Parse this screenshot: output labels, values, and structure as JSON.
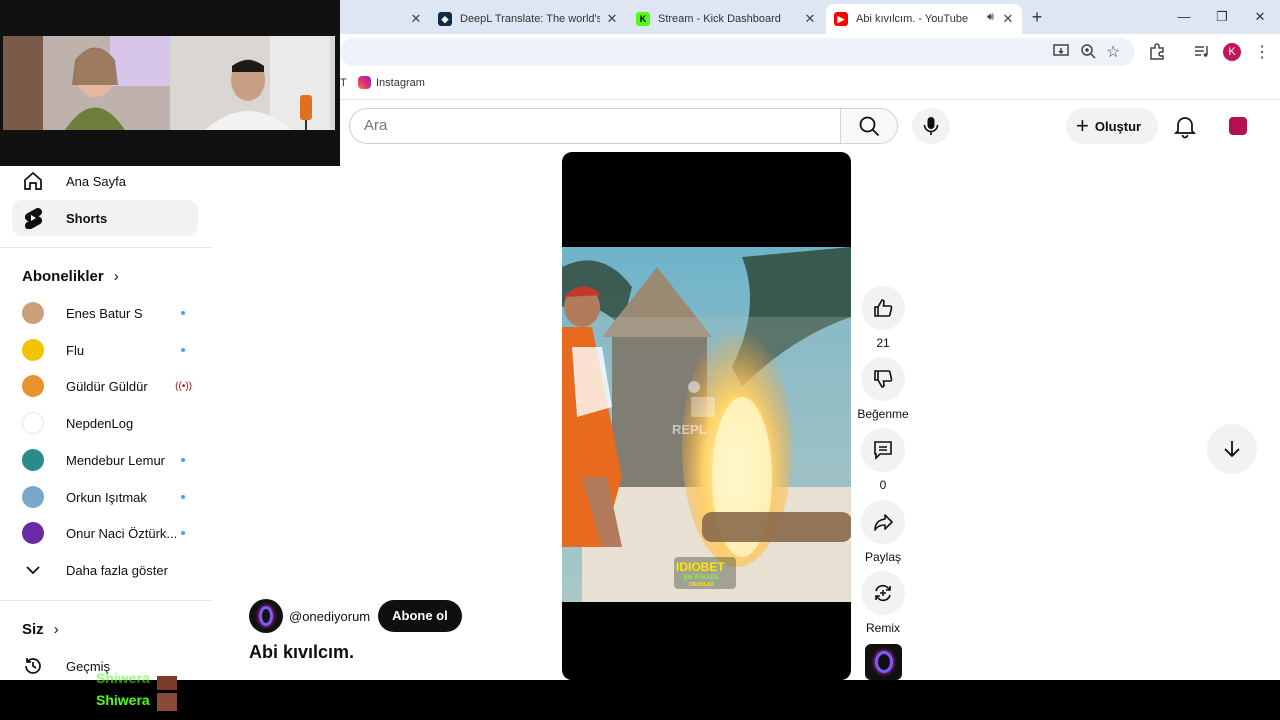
{
  "browser": {
    "tabs": [
      {
        "title": "",
        "favicon": "blank"
      },
      {
        "title": "DeepL Translate: The world's m",
        "favicon": "deepl-icon"
      },
      {
        "title": "Stream - Kick Dashboard",
        "favicon": "kick-icon"
      },
      {
        "title": "Abi kıvılcım. - YouTube",
        "favicon": "youtube-icon"
      }
    ],
    "bookmarks": [
      {
        "label": "T"
      },
      {
        "label": "Instagram"
      }
    ],
    "profile_initial": "K"
  },
  "header": {
    "search_placeholder": "Ara",
    "create_label": "Oluştur"
  },
  "sidebar": {
    "nav": [
      {
        "label": "Ana Sayfa",
        "icon": "home-icon"
      },
      {
        "label": "Shorts",
        "icon": "shorts-icon",
        "active": true
      }
    ],
    "subscriptions_title": "Abonelikler",
    "subscriptions": [
      {
        "name": "Enes Batur S",
        "indicator": "dot",
        "color": "#c9a07a"
      },
      {
        "name": "Flu",
        "indicator": "dot",
        "color": "#f5c400"
      },
      {
        "name": "Güldür Güldür",
        "indicator": "live",
        "color": "#e8912d"
      },
      {
        "name": "NepdenLog",
        "indicator": "none",
        "color": "#ffffff"
      },
      {
        "name": "Mendebur Lemur",
        "indicator": "dot",
        "color": "#2b8a8a"
      },
      {
        "name": "Orkun Işıtmak",
        "indicator": "dot",
        "color": "#7aa7c7"
      },
      {
        "name": "Onur Naci Öztürk...",
        "indicator": "dot",
        "color": "#6a2aa8"
      }
    ],
    "show_more": "Daha fazla göster",
    "you_title": "Siz",
    "history": "Geçmiş"
  },
  "short": {
    "likes": "21",
    "dislike_label": "Beğenme",
    "comments": "0",
    "share_label": "Paylaş",
    "remix_label": "Remix",
    "channel_handle": "@onediyorum",
    "subscribe_label": "Abone ol",
    "title": "Abi kıvılcım.",
    "watermark": "REPL",
    "sponsor_line1": "IDIOBET",
    "sponsor_line2": "EN YÜKSEK",
    "sponsor_line3": "ORANLAR"
  },
  "stream": {
    "chat_names": [
      "Shiwera",
      "Shiwera"
    ]
  },
  "colors": {
    "accent_live": "#53fc18",
    "youtube_red": "#ff0000",
    "subscribe_bg": "#0f0f0f",
    "unread_dot": "#3ea6ff"
  }
}
